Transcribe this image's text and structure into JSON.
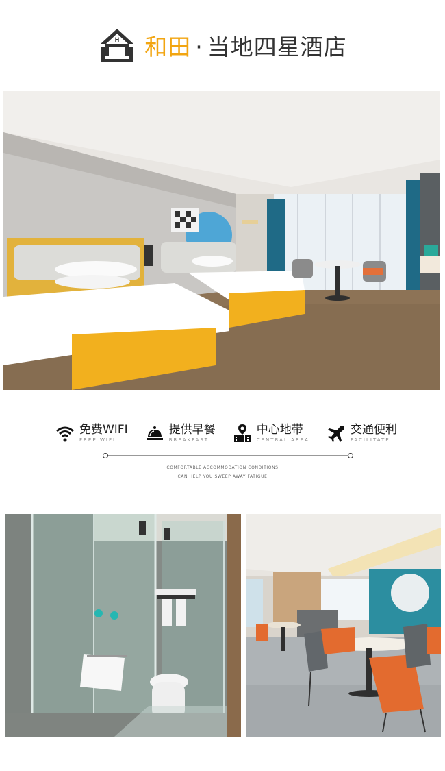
{
  "header": {
    "city": "和田",
    "separator": "·",
    "rest": "当地四星酒店",
    "logo_letter": "H",
    "accent_color": "#f2a511"
  },
  "features": [
    {
      "icon": "wifi-icon",
      "zh": "免费WIFI",
      "en": "FREE WIFI"
    },
    {
      "icon": "service-bell-icon",
      "zh": "提供早餐",
      "en": "BREAKFAST"
    },
    {
      "icon": "location-building-icon",
      "zh": "中心地带",
      "en": "CENTRAL AREA"
    },
    {
      "icon": "airplane-icon",
      "zh": "交通便利",
      "en": "FACILITATE"
    }
  ],
  "tagline": {
    "line1": "COMFORTABLE ACCOMMODATION CONDITIONS",
    "line2": "CAN HELP YOU SWEEP AWAY FATIGUE"
  },
  "photos": {
    "room": "hotel-twin-room-photo",
    "bath": "bathroom-shower-photo",
    "dining": "dining-area-photo"
  }
}
